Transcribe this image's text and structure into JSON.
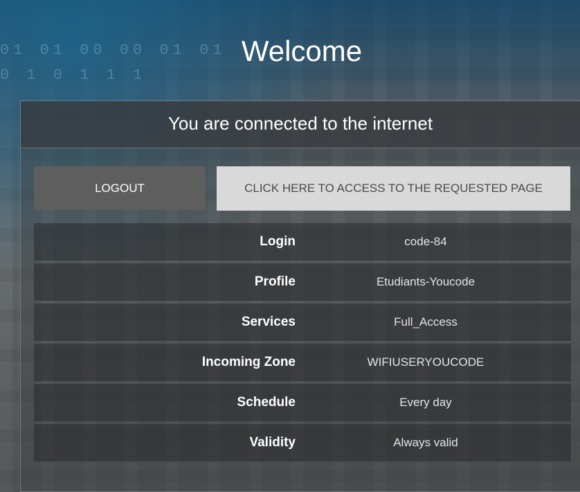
{
  "title": "Welcome",
  "status": "You are connected to the internet",
  "buttons": {
    "logout": "LOGOUT",
    "access": "CLICK HERE TO ACCESS TO THE REQUESTED PAGE"
  },
  "info": {
    "rows": [
      {
        "label": "Login",
        "value": "code-84"
      },
      {
        "label": "Profile",
        "value": "Etudiants-Youcode"
      },
      {
        "label": "Services",
        "value": "Full_Access"
      },
      {
        "label": "Incoming Zone",
        "value": "WIFIUSERYOUCODE"
      },
      {
        "label": "Schedule",
        "value": "Every day"
      },
      {
        "label": "Validity",
        "value": "Always valid"
      }
    ]
  },
  "colors": {
    "logout_bg": "#5e5e5e",
    "access_bg": "#d9d9d9",
    "text": "#ffffff"
  }
}
